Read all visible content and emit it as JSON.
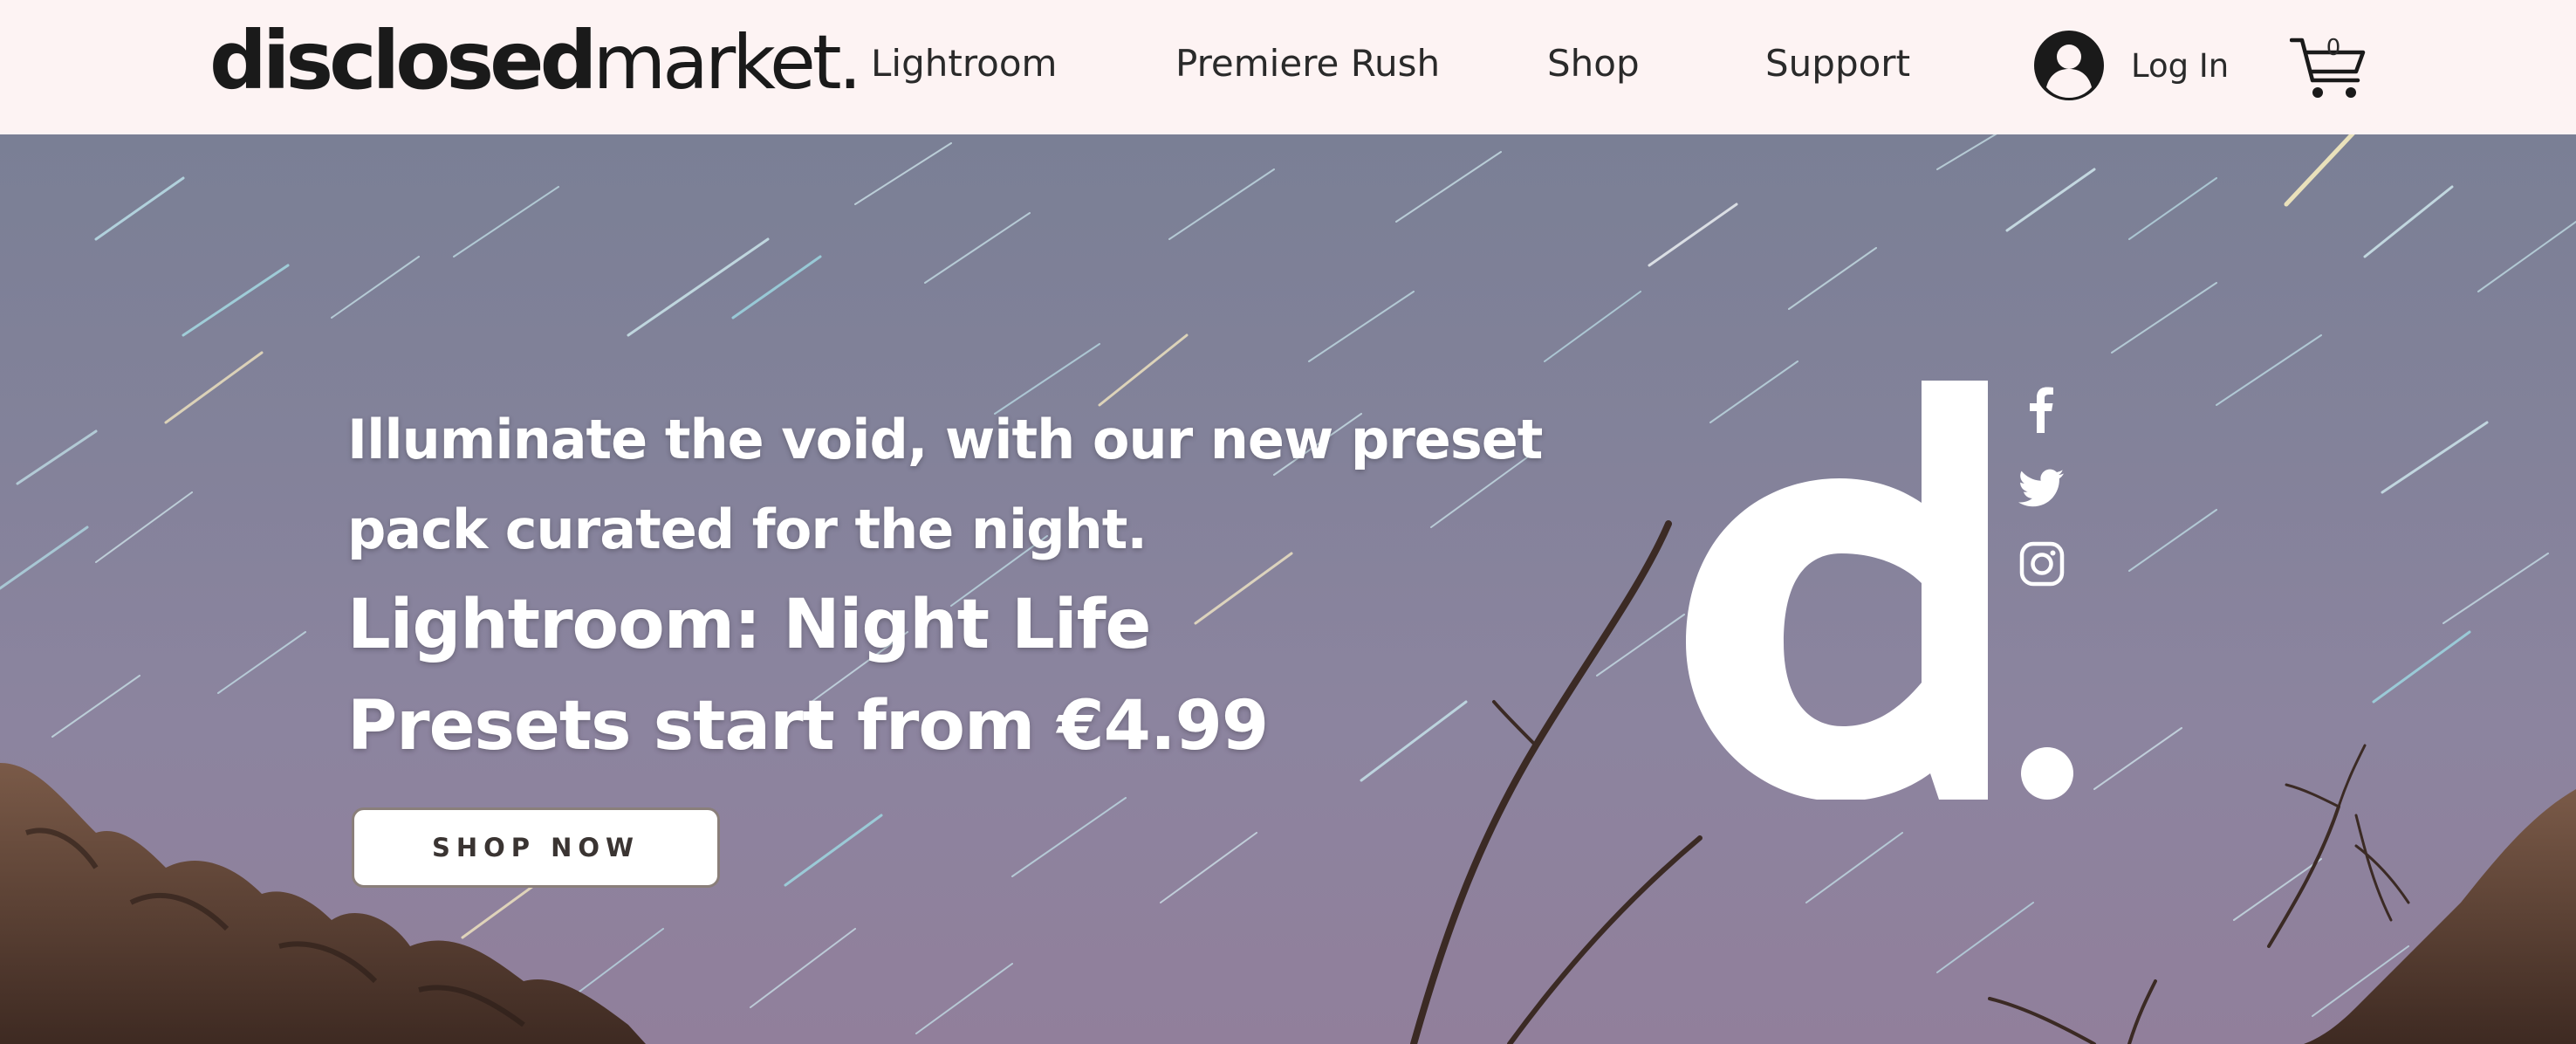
{
  "header": {
    "logo_bold": "disclosed",
    "logo_light": "market.",
    "nav": [
      "Lightroom",
      "Premiere Rush",
      "Shop",
      "Support"
    ],
    "login_label": "Log In",
    "cart_count": "0",
    "background": "#fdf3f3"
  },
  "hero": {
    "tagline_line1": "Illuminate the void, with our new preset",
    "tagline_line2": "pack curated for the night.",
    "title": "Lightroom: Night Life",
    "price_line": "Presets start from €4.99",
    "button_label": "SHOP NOW",
    "brand_mark": "d.",
    "social_icons": [
      "facebook-icon",
      "twitter-icon",
      "instagram-icon"
    ]
  },
  "colors": {
    "sky": "#83829a",
    "text": "#ffffff",
    "header_text": "#2a2a2a"
  }
}
